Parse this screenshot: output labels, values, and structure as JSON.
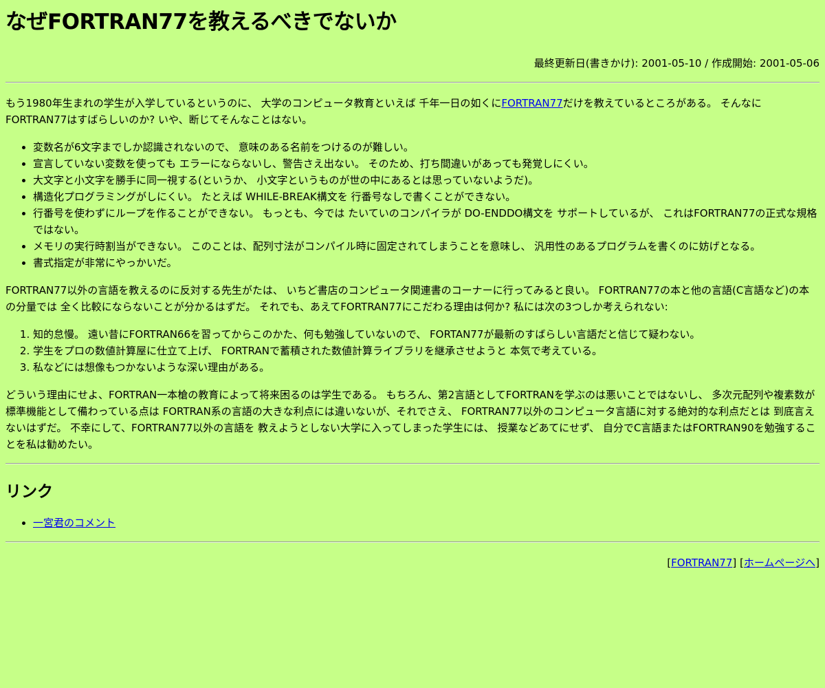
{
  "title": "なぜFORTRAN77を教えるべきでないか",
  "updated": "最終更新日(書きかけ): 2001-05-10 / 作成開始: 2001-05-06",
  "intro": {
    "before_link": "もう1980年生まれの学生が入学しているというのに、 大学のコンピュータ教育といえば 千年一日の如くに",
    "link_text": "FORTRAN77",
    "after_link": "だけを教えているところがある。 そんなにFORTRAN77はすばらしいのか? いや、断じてそんなことはない。"
  },
  "problems": [
    "変数名が6文字までしか認識されないので、 意味のある名前をつけるのが難しい。",
    "宣言していない変数を使っても エラーにならないし、警告さえ出ない。 そのため、打ち間違いがあっても発覚しにくい。",
    "大文字と小文字を勝手に同一視する(というか、 小文字というものが世の中にあるとは思っていないようだ)。",
    "構造化プログラミングがしにくい。 たとえば WHILE-BREAK構文を 行番号なしで書くことができない。",
    "行番号を使わずにループを作ることができない。 もっとも、今では たいていのコンパイラが DO-ENDDO構文を サポートしているが、 これはFORTRAN77の正式な規格ではない。",
    "メモリの実行時割当ができない。 このことは、配列寸法がコンパイル時に固定されてしまうことを意味し、 汎用性のあるプログラムを書くのに妨げとなる。",
    "書式指定が非常にやっかいだ。"
  ],
  "teachers_paragraph": "FORTRAN77以外の言語を教えるのに反対する先生がたは、 いちど書店のコンピュータ関連書のコーナーに行ってみると良い。 FORTRAN77の本と他の言語(C言語など)の本の分量では 全く比較にならないことが分かるはずだ。 それでも、あえてFORTRAN77にこだわる理由は何か? 私には次の3つしか考えられない:",
  "reasons": [
    "知的怠慢。 遠い昔にFORTRAN66を習ってからこのかた、何も勉強していないので、 FORTAN77が最新のすばらしい言語だと信じて疑わない。",
    "学生をプロの数値計算屋に仕立て上げ、 FORTRANで蓄積された数値計算ライブラリを継承させようと 本気で考えている。",
    "私などには想像もつかないような深い理由がある。"
  ],
  "conclusion": "どういう理由にせよ、FORTRAN一本槍の教育によって将来困るのは学生である。 もちろん、第2言語としてFORTRANを学ぶのは悪いことではないし、 多次元配列や複素数が標準機能として備わっている点は FORTRAN系の言語の大きな利点には違いないが、それでさえ、 FORTRAN77以外のコンピュータ言語に対する絶対的な利点だとは 到底言えないはずだ。 不幸にして、FORTRAN77以外の言語を 教えようとしない大学に入ってしまった学生には、 授業などあてにせず、 自分でC言語またはFORTRAN90を勉強することを私は勧めたい。",
  "links_heading": "リンク",
  "links": [
    "一宮君のコメント"
  ],
  "footer": {
    "bracket_open": "[",
    "bracket_close": "]",
    "space": " ",
    "fortran_link": "FORTRAN77",
    "home_link": "ホームページへ"
  },
  "colors": {
    "background": "#c6ff88",
    "link": "#0000ee"
  }
}
